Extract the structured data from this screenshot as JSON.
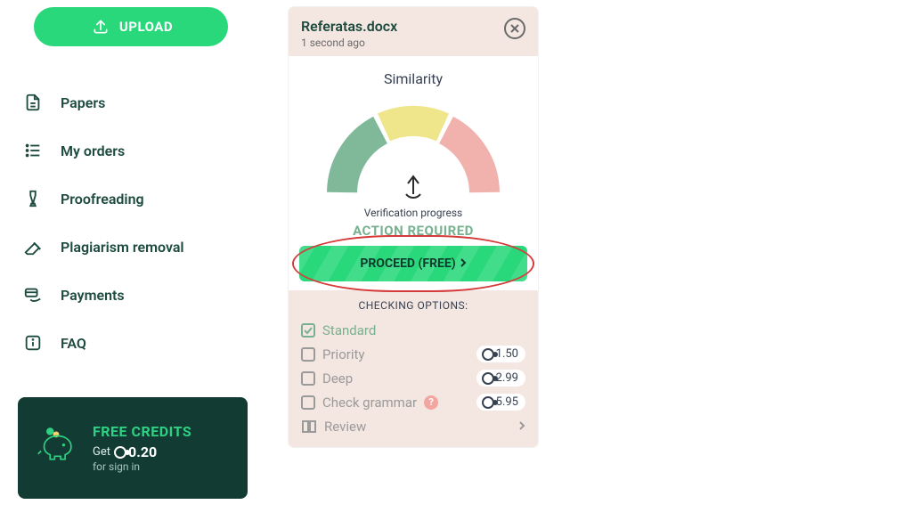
{
  "sidebar": {
    "upload_label": "UPLOAD",
    "items": [
      {
        "label": "Papers",
        "icon": "file-icon"
      },
      {
        "label": "My orders",
        "icon": "list-icon"
      },
      {
        "label": "Proofreading",
        "icon": "highlighter-icon"
      },
      {
        "label": "Plagiarism removal",
        "icon": "eraser-icon"
      },
      {
        "label": "Payments",
        "icon": "card-hand-icon"
      },
      {
        "label": "FAQ",
        "icon": "info-icon"
      }
    ],
    "credits": {
      "title": "FREE CREDITS",
      "prefix": "Get",
      "amount": "0.20",
      "sub": "for sign in"
    }
  },
  "card": {
    "file_name": "Referatas.docx",
    "timestamp": "1 second ago",
    "similarity_label": "Similarity",
    "verification_label": "Verification progress",
    "action_label": "ACTION REQUIRED",
    "proceed_label": "PROCEED (FREE)",
    "options_title": "CHECKING OPTIONS:",
    "options": [
      {
        "label": "Standard",
        "selected": true,
        "price": null,
        "help": false
      },
      {
        "label": "Priority",
        "selected": false,
        "price": "1.50",
        "help": false
      },
      {
        "label": "Deep",
        "selected": false,
        "price": "2.99",
        "help": false
      },
      {
        "label": "Check grammar",
        "selected": false,
        "price": "5.95",
        "help": true
      }
    ],
    "review_label": "Review"
  }
}
